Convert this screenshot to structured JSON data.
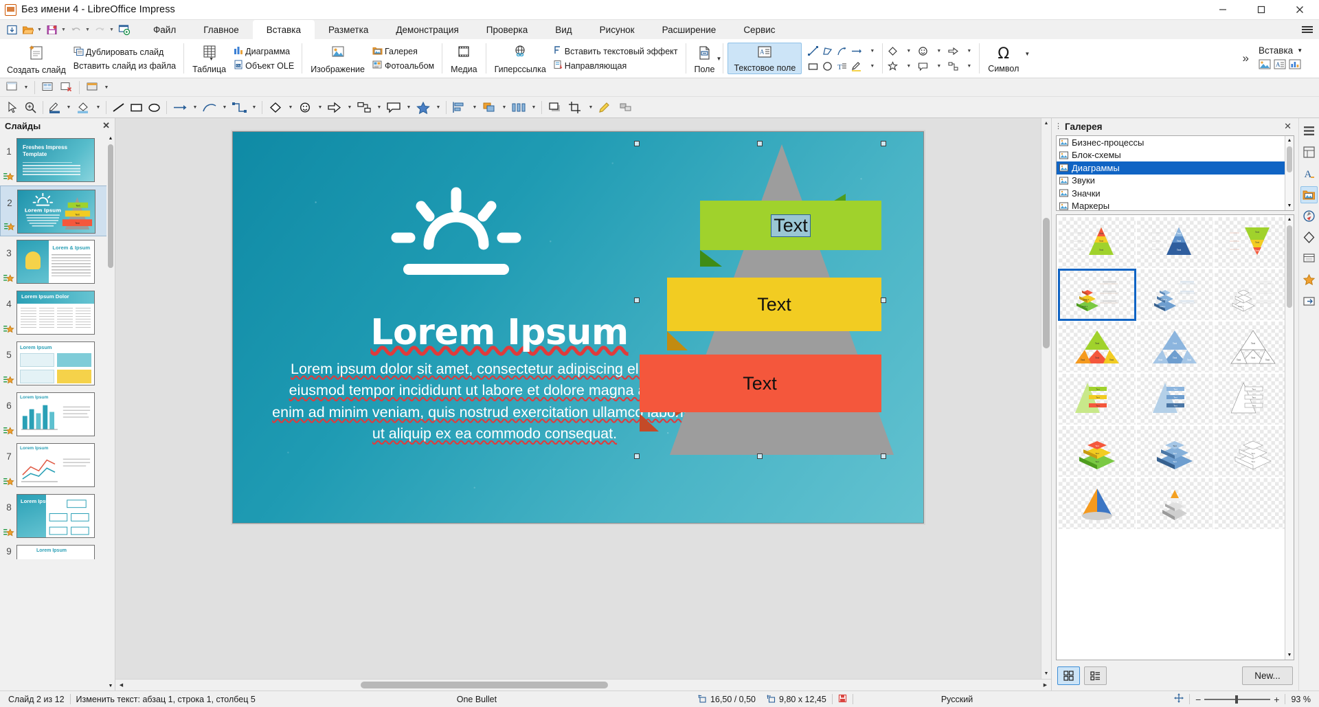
{
  "window": {
    "title": "Без имени 4 - LibreOffice Impress",
    "minimize": "—",
    "maximize": "▢",
    "close": "✕"
  },
  "tabs": [
    {
      "label": "Файл",
      "active": false
    },
    {
      "label": "Главное",
      "active": false
    },
    {
      "label": "Вставка",
      "active": true
    },
    {
      "label": "Разметка",
      "active": false
    },
    {
      "label": "Демонстрация",
      "active": false
    },
    {
      "label": "Проверка",
      "active": false
    },
    {
      "label": "Вид",
      "active": false
    },
    {
      "label": "Рисунок",
      "active": false
    },
    {
      "label": "Расширение",
      "active": false
    },
    {
      "label": "Сервис",
      "active": false
    }
  ],
  "ribbon": {
    "new_slide": "Создать слайд",
    "duplicate_slide": "Дублировать слайд",
    "insert_slide_from_file": "Вставить слайд из файла",
    "table": "Таблица",
    "chart": "Диаграмма",
    "ole_object": "Объект OLE",
    "image": "Изображение",
    "gallery": "Галерея",
    "photo_album": "Фотоальбом",
    "media": "Медиа",
    "hyperlink": "Гиперссылка",
    "text_effect": "Вставить текстовый эффект",
    "guide": "Направляющая",
    "field": "Поле",
    "text_box": "Текстовое поле",
    "symbol": "Символ",
    "insert_menu": "Вставка",
    "overflow": "»"
  },
  "slide_panel": {
    "title": "Слайды",
    "close": "✕",
    "slides": [
      {
        "num": "1",
        "title": "Freshes Impress Template",
        "kind": "title"
      },
      {
        "num": "2",
        "title": "Lorem Ipsum",
        "kind": "pyramid",
        "selected": true
      },
      {
        "num": "3",
        "title": "Lorem & Ipsum",
        "kind": "bulb"
      },
      {
        "num": "4",
        "title": "Lorem Ipsum Dolor",
        "kind": "four-col"
      },
      {
        "num": "5",
        "title": "Lorem Ipsum",
        "kind": "cards"
      },
      {
        "num": "6",
        "title": "Lorem Ipsum",
        "kind": "barchart"
      },
      {
        "num": "7",
        "title": "Lorem Ipsum",
        "kind": "linechart"
      },
      {
        "num": "8",
        "title": "Lorem Ipsum",
        "kind": "flow"
      },
      {
        "num": "9",
        "title": "Lorem Ipsum",
        "kind": "partial"
      }
    ]
  },
  "slide": {
    "title": "Lorem Ipsum",
    "body": "Lorem ipsum dolor sit amet, consectetur adipiscing elit, sed do eiusmod tempor incididunt ut labore et dolore magna aliqua. Ut enim ad minim veniam, quis nostrud exercitation ullamco laboris nisi ut aliquip ex ea commodo consequat.",
    "pyramid": {
      "levels": [
        {
          "label": "Text",
          "color": "#9ed game",
          "fill": "#a0d22c"
        },
        {
          "label": "Text",
          "fill": "#f2cc22"
        },
        {
          "label": "Text",
          "fill": "#f4573c"
        }
      ]
    },
    "background_color": "#1f9bb3"
  },
  "gallery": {
    "title": "Галерея",
    "close": "✕",
    "themes": [
      {
        "label": "Бизнес-процессы",
        "selected": false
      },
      {
        "label": "Блок-схемы",
        "selected": false
      },
      {
        "label": "Диаграммы",
        "selected": true
      },
      {
        "label": "Звуки",
        "selected": false
      },
      {
        "label": "Значки",
        "selected": false
      },
      {
        "label": "Маркеры",
        "selected": false
      }
    ],
    "items": [
      {
        "id": "pyramid-3-color",
        "selected": false
      },
      {
        "id": "pyramid-3-blue",
        "selected": false
      },
      {
        "id": "funnel-3-color",
        "selected": false
      },
      {
        "id": "pyramid-3d-color",
        "selected": true
      },
      {
        "id": "pyramid-3d-blue",
        "selected": false
      },
      {
        "id": "pyramid-3d-outline",
        "selected": false
      },
      {
        "id": "triangle-split-color",
        "selected": false
      },
      {
        "id": "triangle-split-blue",
        "selected": false
      },
      {
        "id": "triangle-split-outline",
        "selected": false
      },
      {
        "id": "pyramid-labels-color",
        "selected": false
      },
      {
        "id": "pyramid-labels-blue",
        "selected": false
      },
      {
        "id": "pyramid-labels-outline",
        "selected": false
      },
      {
        "id": "stack-3d-color",
        "selected": false
      },
      {
        "id": "stack-3d-blue",
        "selected": false
      },
      {
        "id": "stack-3d-outline",
        "selected": false
      },
      {
        "id": "cone-color",
        "selected": false
      },
      {
        "id": "cone-gray",
        "selected": false
      }
    ],
    "view_icon_label": "icon-view",
    "view_list_label": "list-view",
    "new_button": "New..."
  },
  "status": {
    "slide_count": "Слайд 2 из 12",
    "edit_mode": "Изменить текст: абзац 1, строка 1, столбец 5",
    "style": "One Bullet",
    "position": "16,50 / 0,50",
    "size": "9,80 x 12,45",
    "language": "Русский",
    "zoom": "93 %"
  }
}
